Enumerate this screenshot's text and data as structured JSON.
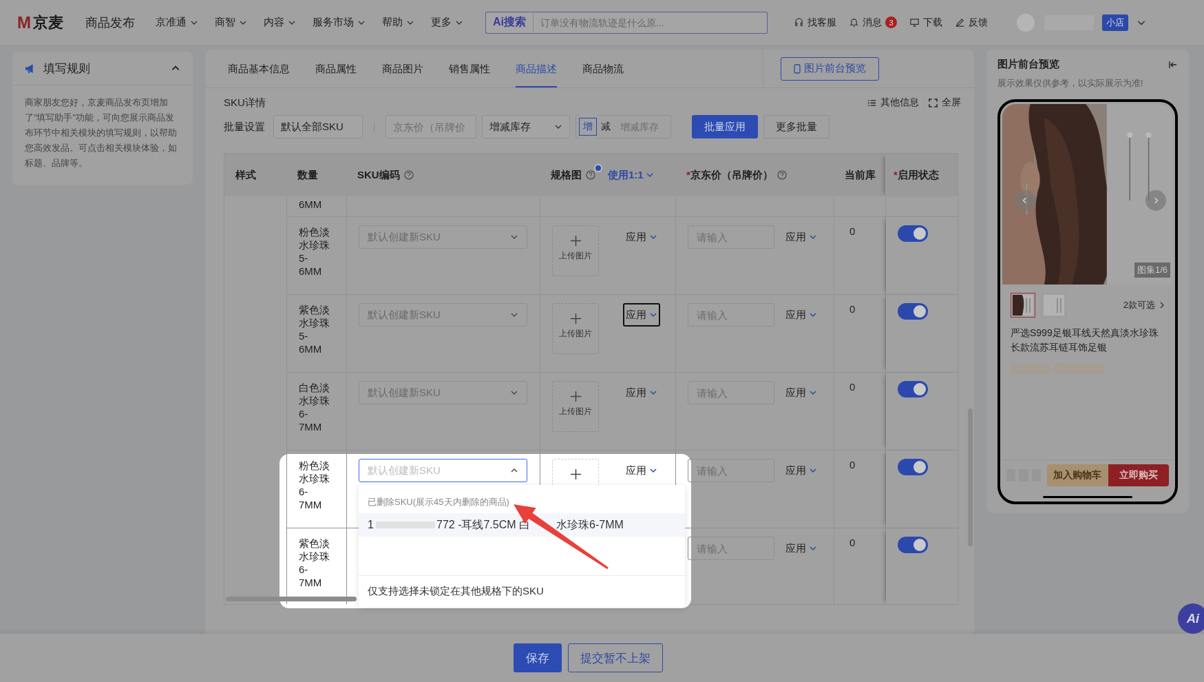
{
  "topbar": {
    "logo_mark": "M",
    "logo_text": "京麦",
    "page_title": "商品发布",
    "menus": [
      "京准通",
      "商智",
      "内容",
      "服务市场",
      "帮助",
      "更多"
    ],
    "search": {
      "badge": "Ai搜索",
      "placeholder": "订单没有物流轨迹是什么原..."
    },
    "actions": [
      {
        "kind": "headset",
        "label": "找客服"
      },
      {
        "kind": "bell",
        "label": "消息",
        "badge": "3"
      },
      {
        "kind": "monitor",
        "label": "下载"
      },
      {
        "kind": "pen",
        "label": "反馈"
      }
    ],
    "shop_badge": "小店"
  },
  "rules_panel": {
    "title": "填写规则",
    "expanded": true,
    "text": "商家朋友您好，京麦商品发布页增加了\"填写助手\"功能，可向您展示商品发布环节中相关模块的填写规则，以帮助您高效发品。可点击相关模块体验，如标题、品牌等。"
  },
  "tabs": [
    {
      "label": "商品基本信息",
      "selected": false
    },
    {
      "label": "商品属性",
      "selected": false
    },
    {
      "label": "商品图片",
      "selected": false
    },
    {
      "label": "销售属性",
      "selected": false
    },
    {
      "label": "商品描述",
      "selected": true
    },
    {
      "label": "商品物流",
      "selected": false
    }
  ],
  "preview_button": "图片前台预览",
  "sku": {
    "title": "SKU详情",
    "tools": [
      {
        "kind": "list",
        "label": "其他信息"
      },
      {
        "kind": "fullscreen",
        "label": "全屏"
      }
    ],
    "batch": {
      "label": "批量设置",
      "scope": "默认全部SKU",
      "price_placeholder": "京东价（吊牌价",
      "stock_mode": "增减库存",
      "ops": [
        {
          "label": "增",
          "selected": true
        },
        {
          "label": "减",
          "selected": false
        }
      ],
      "stock_placeholder": "增减库存",
      "apply": "批量应用",
      "more": "更多批量"
    },
    "columns": [
      {
        "label": "样式"
      },
      {
        "label": "数量"
      },
      {
        "label": "SKU编码",
        "help": true
      },
      {
        "label": "规格图",
        "help": true,
        "dot": true,
        "extra": "使用1:1"
      },
      {
        "label": "京东价（吊牌价）",
        "mark": "*",
        "help": true
      },
      {
        "label": "当前库"
      },
      {
        "label": "启用状态",
        "mark": "*"
      }
    ],
    "rows": [
      {
        "kind": "partial",
        "quantity": "6MM"
      },
      {
        "kind": "full",
        "quantity": "粉色淡水珍珠5-6MM",
        "sku": {
          "placeholder": "默认创建新SKU",
          "open": false
        },
        "upload": {
          "kind": "full",
          "label": "上传图片"
        },
        "spec_apply": {
          "label": "应用",
          "focused": false
        },
        "price": {
          "placeholder": "请输入"
        },
        "price_apply": "应用",
        "stock": "0",
        "enabled": true
      },
      {
        "kind": "full",
        "quantity": "紫色淡水珍珠5-6MM",
        "sku": {
          "placeholder": "默认创建新SKU",
          "open": false
        },
        "upload": {
          "kind": "full",
          "label": "上传图片"
        },
        "spec_apply": {
          "label": "应用",
          "focused": true
        },
        "price": {
          "placeholder": "请输入"
        },
        "price_apply": "应用",
        "stock": "0",
        "enabled": true
      },
      {
        "kind": "full",
        "quantity": "白色淡水珍珠6-7MM",
        "sku": {
          "placeholder": "默认创建新SKU",
          "open": false
        },
        "upload": {
          "kind": "full",
          "label": "上传图片"
        },
        "spec_apply": {
          "label": "应用",
          "focused": false
        },
        "price": {
          "placeholder": "请输入"
        },
        "price_apply": "应用",
        "stock": "0",
        "enabled": true
      },
      {
        "kind": "full",
        "quantity": "粉色淡水珍珠6-7MM",
        "sku": {
          "placeholder": "默认创建新SKU",
          "open": true
        },
        "upload": {
          "kind": "plus"
        },
        "spec_apply": {
          "label": "应用",
          "focused": false
        },
        "price": {
          "placeholder": "请输入"
        },
        "price_apply": "应用",
        "stock": "0",
        "enabled": true
      },
      {
        "kind": "full",
        "quantity": "紫色淡水珍珠6-7MM",
        "price": {
          "placeholder": "请输入"
        },
        "price_apply": "应用",
        "stock": "0",
        "enabled": true
      }
    ],
    "dropdown": {
      "header": "已删除SKU(展示45天内删除的商品)",
      "option_parts": [
        "1",
        "772 -耳线7.5CM 白",
        "水珍珠6-7MM"
      ],
      "footer": "仅支持选择未锁定在其他规格下的SKU"
    }
  },
  "preview": {
    "title": "图片前台预览",
    "note": "展示效果仅供参考，以实际展示为准!",
    "counter": "图集1/6",
    "thumbnails": [
      {
        "selected": true
      },
      {
        "selected": false
      }
    ],
    "variants": "2款可选",
    "product_title": "严选S999足银耳线天然真淡水珍珠长款流苏耳链耳饰足银",
    "cart": "加入购物车",
    "buy": "立即购买"
  },
  "footer": {
    "save": "保存",
    "submit": "提交暂不上架"
  },
  "ai_button": "Ai"
}
